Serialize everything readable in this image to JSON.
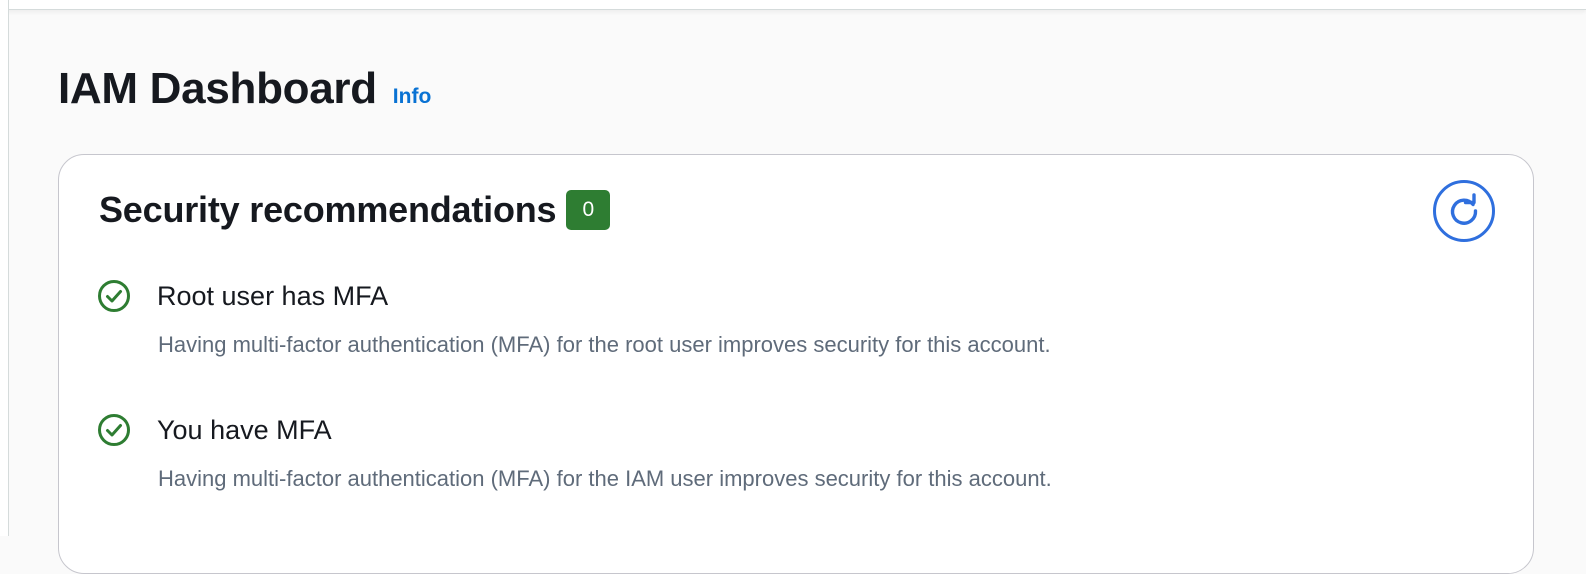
{
  "page": {
    "title": "IAM Dashboard",
    "info_link": "Info"
  },
  "security": {
    "title": "Security recommendations",
    "count": "0",
    "refresh_icon": "refresh-icon",
    "items": [
      {
        "title": "Root user has MFA",
        "description": "Having multi-factor authentication (MFA) for the root user improves security for this account.",
        "status_icon": "check-circle-icon"
      },
      {
        "title": "You have MFA",
        "description": "Having multi-factor authentication (MFA) for the IAM user improves security for this account.",
        "status_icon": "check-circle-icon"
      }
    ]
  },
  "colors": {
    "accent": "#0972d3",
    "success": "#2e7d32",
    "refresh_blue": "#2f6fde",
    "text_primary": "#16191f",
    "text_secondary": "#5f6b7a"
  }
}
